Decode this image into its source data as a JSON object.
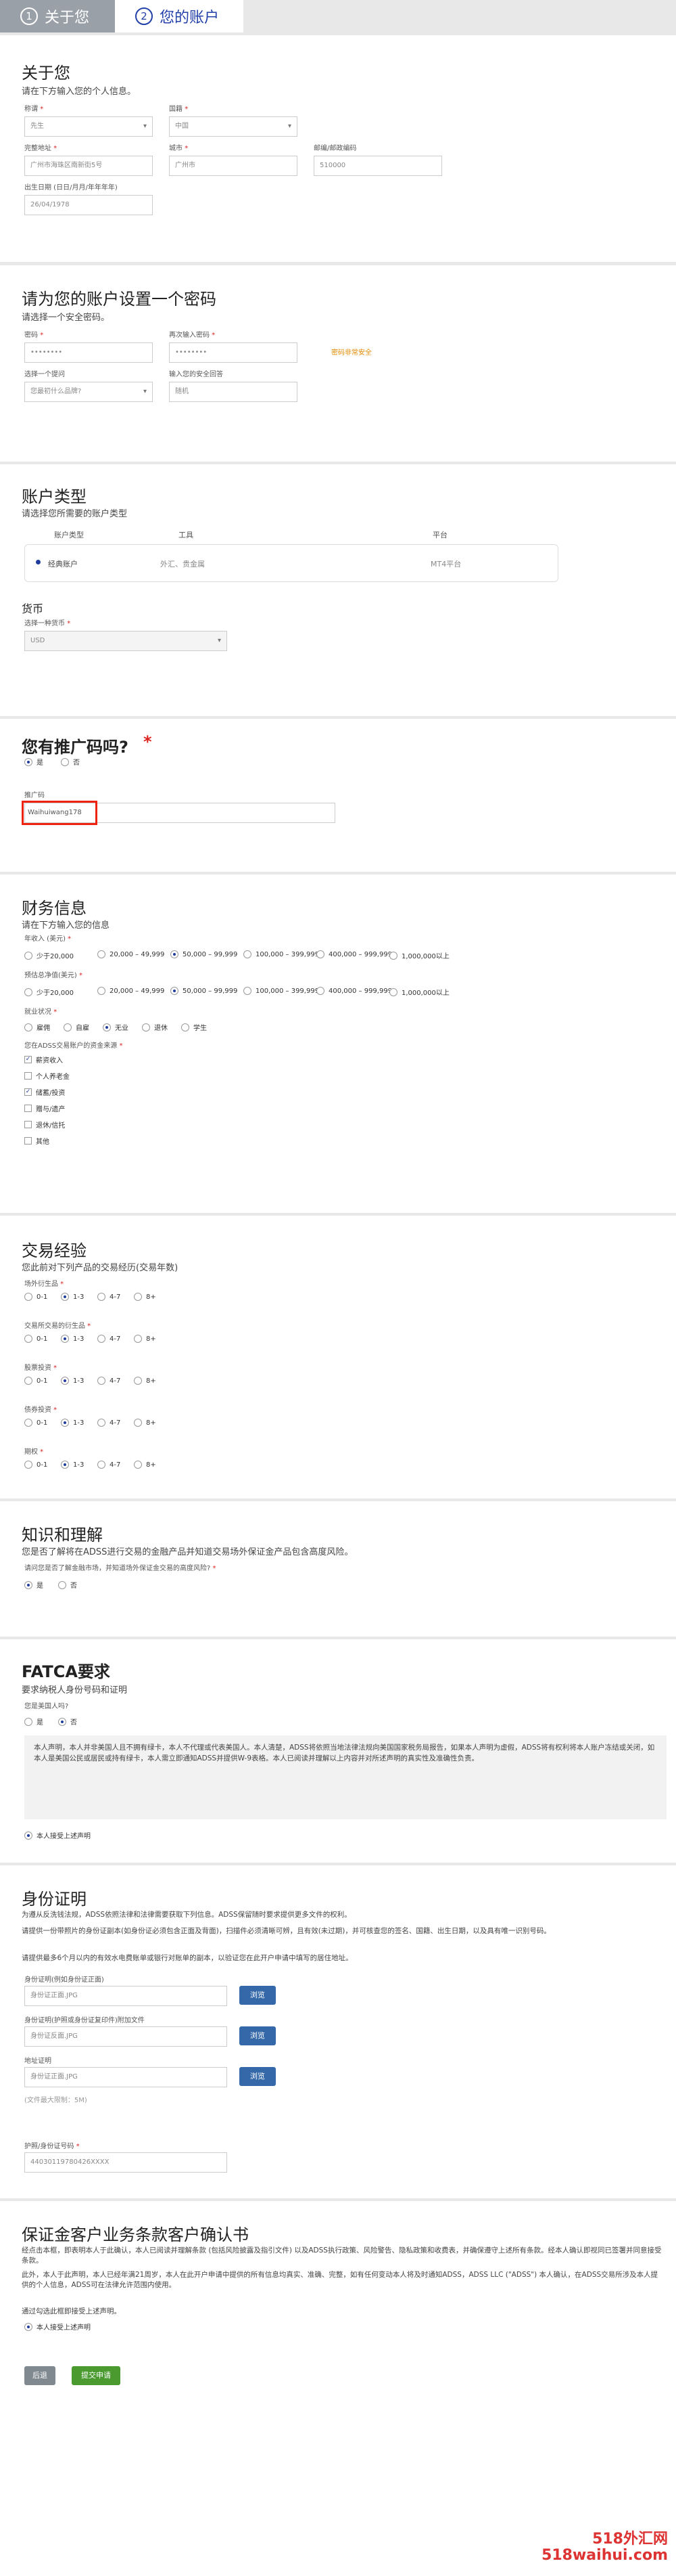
{
  "steps": [
    {
      "num": "1",
      "label": "关于您"
    },
    {
      "num": "2",
      "label": "您的账户"
    }
  ],
  "about": {
    "title": "关于您",
    "subtitle": "请在下方输入您的个人信息。",
    "fields": {
      "title_label": "称谓",
      "title_value": "先生",
      "country_label": "国籍",
      "country_value": "中国",
      "address_label": "完整地址",
      "address_value": "广州市海珠区南新街5号",
      "city_label": "城市",
      "city_value": "广州市",
      "zip_label": "邮编/邮政编码",
      "zip_value": "510000",
      "dob_label": "出生日期 (日日/月月/年年年年)",
      "dob_value": "26/04/1978"
    }
  },
  "password": {
    "title": "请为您的账户设置一个密码",
    "subtitle": "请选择一个安全密码。",
    "pw_label": "密码",
    "pw_value": "••••••••",
    "pw2_label": "再次输入密码",
    "pw2_value": "••••••••",
    "hint": "密码非常安全",
    "q_label": "选择一个提问",
    "q_value": "您最初什么品牌?",
    "a_label": "输入您的安全回答",
    "a_value": "随机"
  },
  "account": {
    "title": "账户类型",
    "subtitle": "请选择您所需要的账户类型",
    "cols": [
      "账户类型",
      "工具",
      "平台"
    ],
    "row": {
      "type": "经典账户",
      "tools": "外汇、贵金属",
      "platform": "MT4平台"
    },
    "currency_title": "货币",
    "currency_label": "选择一种货币",
    "currency_value": "USD"
  },
  "referral": {
    "title": "您有推广码吗?",
    "yes": "是",
    "no": "否",
    "code_label": "推广码",
    "code_value": "Waihuiwang178"
  },
  "finance": {
    "title": "财务信息",
    "subtitle": "请在下方输入您的信息",
    "income_label": "年收入 (美元)",
    "income_opts": [
      "少于20,000",
      "20,000 – 49,999",
      "50,000 – 99,999",
      "100,000 – 399,999",
      "400,000 – 999,999",
      "1,000,000以上"
    ],
    "assets_label": "预估总净值(美元)",
    "assets_opts": [
      "少于20,000",
      "20,000 – 49,999",
      "50,000 – 99,999",
      "100,000 – 399,999",
      "400,000 – 999,999",
      "1,000,000以上"
    ],
    "employ_label": "就业状况",
    "employ_opts": [
      "雇佣",
      "自雇",
      "无业",
      "退休",
      "学生"
    ],
    "source_label": "您在ADSS交易账户的资金来源",
    "source_opts": [
      "薪资收入",
      "个人养老金",
      "储蓄/投资",
      "赠与/遗产",
      "退休/信托",
      "其他"
    ]
  },
  "trading": {
    "title": "交易经验",
    "subtitle": "您此前对下列产品的交易经历(交易年数)",
    "groups": [
      {
        "label": "场外衍生品"
      },
      {
        "label": "交易所交易的衍生品"
      },
      {
        "label": "股票投资"
      },
      {
        "label": "债券投资"
      },
      {
        "label": "期权"
      }
    ],
    "opts": [
      "0-1",
      "1-3",
      "4-7",
      "8+"
    ]
  },
  "knowledge": {
    "title": "知识和理解",
    "subtitle": "您是否了解将在ADSS进行交易的金融产品并知道交易场外保证金产品包含高度风险。",
    "q": "请问您是否了解金融市场，并知道场外保证金交易的高度风险?",
    "yes": "是",
    "no": "否"
  },
  "fatca": {
    "title": "FATCA要求",
    "subtitle": "要求纳税人身份号码和证明",
    "q": "您是美国人吗?",
    "yes": "是",
    "no": "否",
    "declare": "本人声明，本人并非美国人且不拥有绿卡，本人不代理或代表美国人。本人清楚，ADSS将依照当地法律法规向美国国家税务局报告，如果本人声明为虚假，ADSS将有权利将本人账户冻结或关闭，如本人是美国公民或居民或持有绿卡，本人需立即通知ADSS并提供W-9表格。本人已阅读并理解以上内容并对所述声明的真实性及准确性负责。",
    "confirm": "本人接受上述声明"
  },
  "identity": {
    "title": "身份证明",
    "subtitle": "为遵从反洗钱法规，ADSS依照法律和法律需要获取下列信息。ADSS保留随时要求提供更多文件的权利。",
    "p1": "请提供一份带照片的身份证副本(如身份证必须包含正面及背面)，扫描件必须清晰可辨，且有效(未过期)，并可核查您的签名、国籍、出生日期，以及具有唯一识别号码。",
    "p2": "请提供最多6个月以内的有效水电费账单或银行对账单的副本，以验证您在此开户申请中填写的居住地址。",
    "f1_label": "身份证明(例如身份证正面)",
    "f1_ph": "身份证正面.JPG",
    "f2_label": "身份证明(护照或身份证复印件)附加文件",
    "f2_ph": "身份证反面.JPG",
    "f3_label": "地址证明",
    "f3_ph": "身份证正面.JPG",
    "browse": "浏览",
    "note": "(文件最大限制：5M)"
  },
  "id_number": {
    "label": "护照/身份证号码",
    "value": "44030119780426XXXX"
  },
  "confirmation": {
    "title": "保证金客户业务条款客户确认书",
    "p1": "经点击本框，即表明本人于此确认，本人已阅读并理解条款 (包括风险披露及指引文件) 以及ADSS执行政策、风险警告、隐私政策和收费表，并确保遵守上述所有条款。经本人确认即视同已签署并同意接受条款。",
    "p2": "此外，本人于此声明，本人已经年满21周岁，本人在此开户申请中提供的所有信息均真实、准确、完整，如有任何变动本人将及时通知ADSS，ADSS LLC (\"ADSS\") 本人确认，在ADSS交易所涉及本人提供的个人信息，ADSS可在法律允许范围内使用。",
    "p3": "通过勾选此框即接受上述声明。",
    "confirm": "本人接受上述声明"
  },
  "buttons": {
    "back": "后退",
    "submit": "提交申请"
  },
  "watermark": "518外汇网\n518waihui.com"
}
